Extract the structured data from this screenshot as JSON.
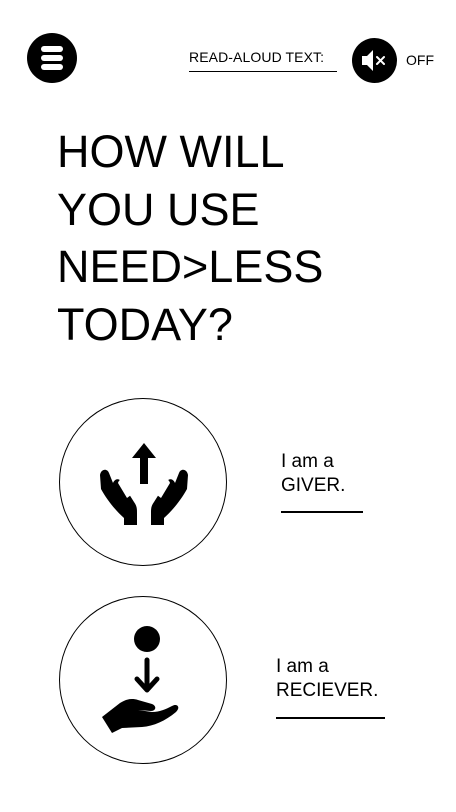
{
  "header": {
    "menu_icon": "hamburger-menu-icon",
    "read_aloud_label": "READ-ALOUD TEXT:",
    "audio_icon": "speaker-muted-icon",
    "audio_state": "OFF"
  },
  "title_lines": [
    "HOW WILL",
    "YOU USE",
    "NEED>LESS",
    "TODAY?"
  ],
  "options": [
    {
      "icon": "hands-giving-icon",
      "line1": "I am a",
      "line2": "GIVER."
    },
    {
      "icon": "hand-receiving-icon",
      "line1": "I am a",
      "line2": "RECIEVER."
    }
  ]
}
